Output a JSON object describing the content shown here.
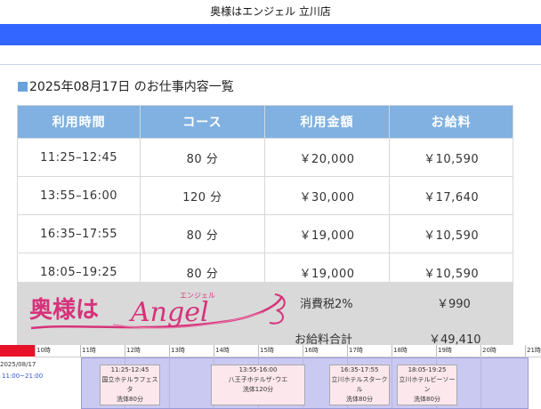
{
  "header": {
    "title": "奥様はエンジェル 立川店"
  },
  "heading": {
    "text": "2025年08月17日 のお仕事内容一覧"
  },
  "table": {
    "columns": [
      "利用時間",
      "コース",
      "利用金額",
      "お給料"
    ],
    "rows": [
      [
        "11:25–12:45",
        "80 分",
        "￥20,000",
        "￥10,590"
      ],
      [
        "13:55–16:00",
        "120 分",
        "￥30,000",
        "￥17,640"
      ],
      [
        "16:35–17:55",
        "80 分",
        "￥19,000",
        "￥10,590"
      ],
      [
        "18:05–19:25",
        "80 分",
        "￥19,000",
        "￥10,590"
      ]
    ]
  },
  "summary": {
    "logo_text": "奥様は",
    "logo_script": "Angel",
    "logo_small": "エンジェル",
    "tax_label": "消費税2%",
    "tax_value": "￥990",
    "total_label": "お給料合計",
    "total_value": "￥49,410"
  },
  "timeline": {
    "hours": [
      "10時",
      "11時",
      "12時",
      "13時",
      "14時",
      "15時",
      "16時",
      "17時",
      "18時",
      "19時",
      "20時",
      "21時"
    ],
    "date": "2025/08/17",
    "shift": "11:00~21:00",
    "jobs": [
      {
        "time": "11:25-12:45",
        "hotel": "国立ホテルラフェスタ",
        "course": "洗体80分"
      },
      {
        "time": "13:55-16:00",
        "hotel": "八王子ホテルザ･ウエ",
        "course": "洗体120分"
      },
      {
        "time": "16:35-17:55",
        "hotel": "立川ホテルスタークル",
        "course": "洗体80分"
      },
      {
        "time": "18:05-19:25",
        "hotel": "立川ホテルビーソーン",
        "course": "洗体80分"
      }
    ]
  },
  "colors": {
    "blue_bar": "#3366ff",
    "table_header": "#80b1e0",
    "summary_bg": "#d9d9d9",
    "logo_pink": "#d6337a",
    "timeline_red": "#e8112a"
  }
}
